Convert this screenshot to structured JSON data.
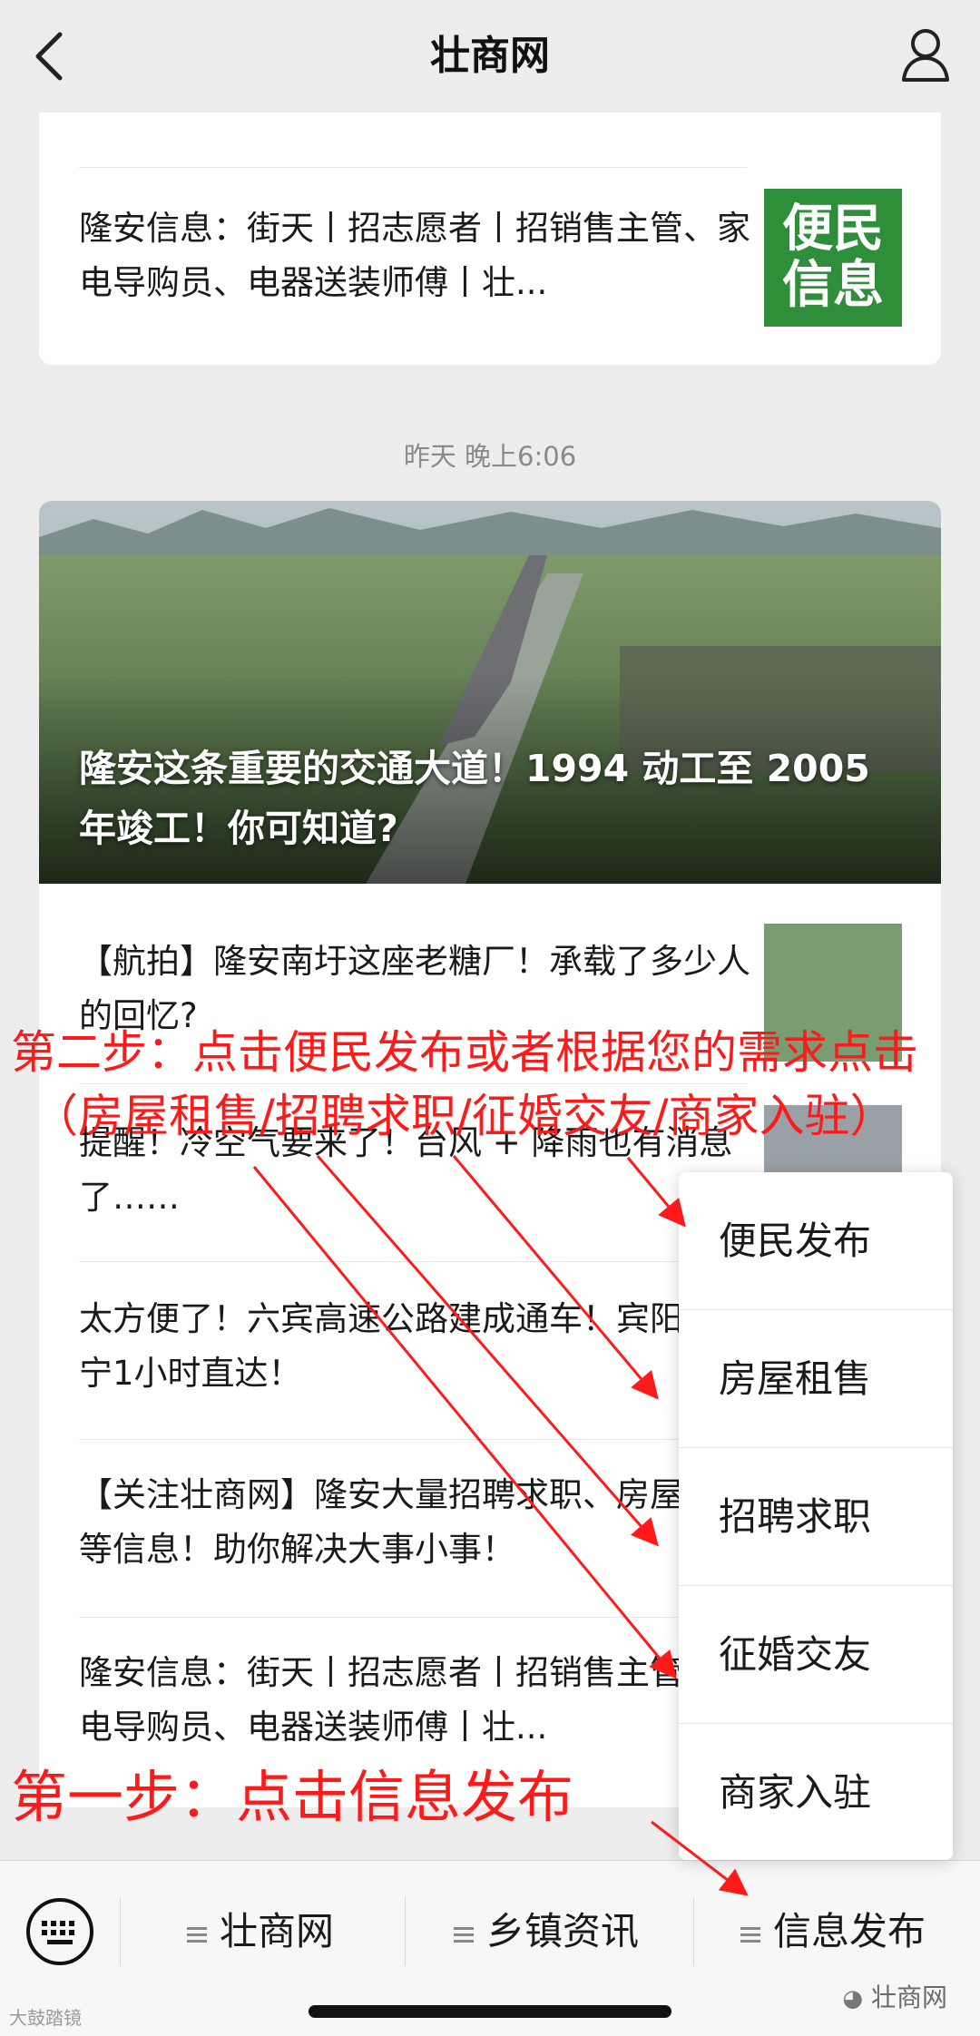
{
  "topbar": {
    "title": "壮商网"
  },
  "card1": {
    "partial_text": "售等信息！助你解决大事小事！",
    "item_text": "隆安信息：街天丨招志愿者丨招销售主管、家电导购员、电器送装师傅丨壮...",
    "thumb_text": "便民信息"
  },
  "time_label": "昨天 晚上6:06",
  "card2": {
    "hero_title": "隆安这条重要的交通大道！1994 动工至 2005 年竣工！你可知道?",
    "items": [
      {
        "text": "【航拍】隆安南圩这座老糖厂！承载了多少人的回忆?"
      },
      {
        "text": "提醒！冷空气要来了！台风 + 降雨也有消息了……"
      },
      {
        "text": "太方便了！六宾高速公路建成通车！宾阳到南宁1小时直达！"
      },
      {
        "text": "【关注壮商网】隆安大量招聘求职、房屋租售等信息！助你解决大事小事！"
      },
      {
        "text": "隆安信息：街天丨招志愿者丨招销售主管、家电导购员、电器送装师傅丨壮..."
      }
    ]
  },
  "popup": {
    "items": [
      "便民发布",
      "房屋租售",
      "招聘求职",
      "征婚交友",
      "商家入驻"
    ]
  },
  "bottom": {
    "tabs": [
      "壮商网",
      "乡镇资讯",
      "信息发布"
    ],
    "watermark_right": "壮商网",
    "watermark_left": "大鼓踏镜"
  },
  "annotations": {
    "step2_line1": "第二步：点击便民发布或者根据您的需求点击",
    "step2_line2": "（房屋租售/招聘求职/征婚交友/商家入驻）",
    "step1": "第一步：点击信息发布",
    "color": "#ff1a1a"
  }
}
